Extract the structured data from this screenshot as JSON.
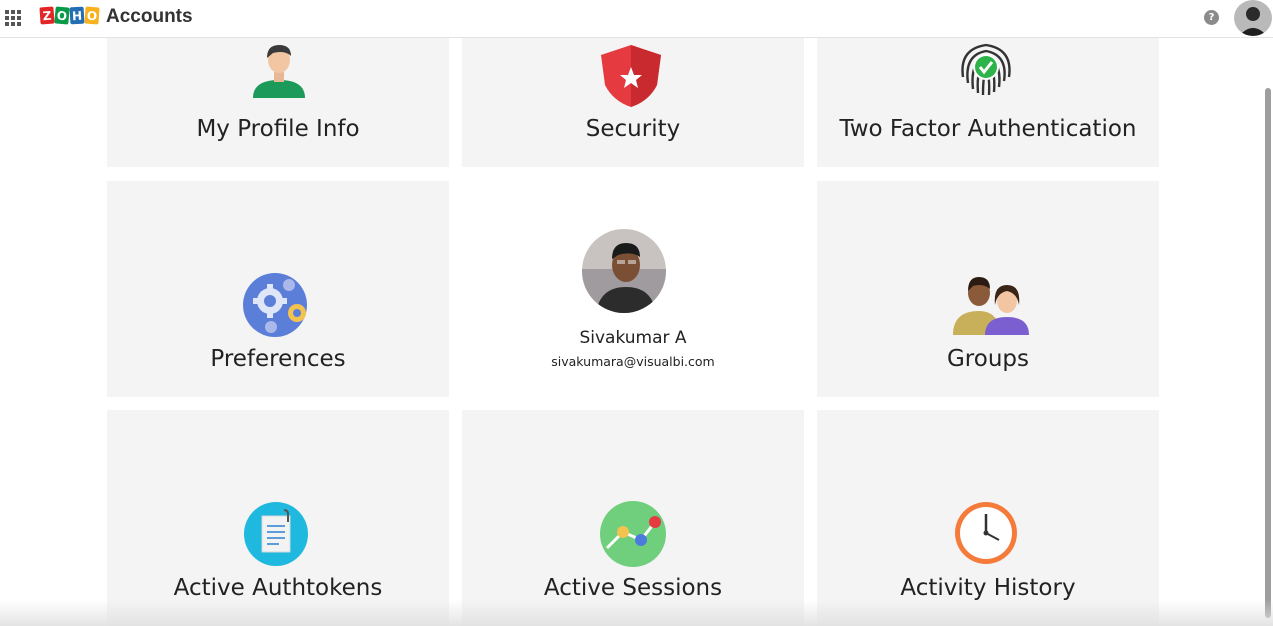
{
  "header": {
    "app_title": "Accounts",
    "logo_letters": [
      "Z",
      "O",
      "H",
      "O"
    ],
    "logo_colors": [
      "#e42527",
      "#089949",
      "#226db4",
      "#f9b21d"
    ],
    "help_label": "?"
  },
  "cards": {
    "profile": {
      "label": "My Profile Info",
      "icon": "user-icon"
    },
    "security": {
      "label": "Security",
      "icon": "shield-icon"
    },
    "two_factor": {
      "label": "Two Factor Authentication",
      "icon": "fingerprint-icon"
    },
    "preferences": {
      "label": "Preferences",
      "icon": "gears-icon"
    },
    "groups": {
      "label": "Groups",
      "icon": "users-icon"
    },
    "authtokens": {
      "label": "Active Authtokens",
      "icon": "clipboard-icon"
    },
    "sessions": {
      "label": "Active Sessions",
      "icon": "sessions-icon"
    },
    "history": {
      "label": "Activity History",
      "icon": "clock-icon"
    }
  },
  "user": {
    "name": "Sivakumar A",
    "email": "sivakumara@visualbi.com"
  },
  "colors": {
    "card_bg": "#f4f4f4",
    "shield_red": "#e53a3f",
    "check_green": "#2db34a",
    "gear_blue": "#5b7fd9",
    "authtoken_cyan": "#1fb8de",
    "sessions_green": "#6fcf7c",
    "clock_orange": "#f57b3b"
  }
}
